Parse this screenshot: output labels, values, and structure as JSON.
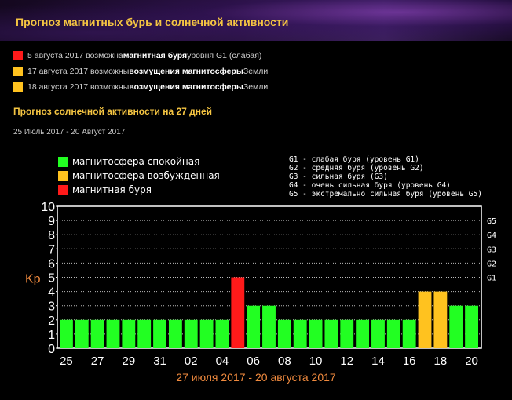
{
  "header": {
    "title": "Прогноз магнитных бурь и солнечной активности"
  },
  "alerts": [
    {
      "color": "#ff1a1a",
      "pre": "5 августа 2017 возможна ",
      "bold": "магнитная буря",
      "post": " уровня G1 (слабая)"
    },
    {
      "color": "#ffc21f",
      "pre": "17 августа 2017 возможны ",
      "bold": "возмущения магнитосферы",
      "post": " Земли"
    },
    {
      "color": "#ffc21f",
      "pre": "18 августа 2017 возможны ",
      "bold": "возмущения магнитосферы",
      "post": " Земли"
    }
  ],
  "forecast": {
    "title": "Прогноз солнечной активности на 27 дней",
    "date_range": "25 Июль 2017 - 20 Август 2017"
  },
  "legend": [
    {
      "label": "магнитосфера спокойная",
      "color": "#22ff22"
    },
    {
      "label": "магнитосфера возбужденная",
      "color": "#ffc21f"
    },
    {
      "label": "магнитная буря",
      "color": "#ff1a1a"
    }
  ],
  "storm_levels": [
    "G1 - слабая буря (уровень G1)",
    "G2 - средняя буря (уровень G2)",
    "G3 - сильная буря (G3)",
    "G4 - очень сильная буря (уровень G4)",
    "G5 - экстремально сильная буря (уровень G5)"
  ],
  "chart_data": {
    "type": "bar",
    "ylabel": "Kp",
    "ylim": [
      0,
      10
    ],
    "yticks": [
      "0",
      "1",
      "2",
      "3",
      "4",
      "5",
      "6",
      "7",
      "8",
      "9",
      "10"
    ],
    "right_ticks": [
      {
        "value": 5,
        "label": "G1"
      },
      {
        "value": 6,
        "label": "G2"
      },
      {
        "value": 7,
        "label": "G3"
      },
      {
        "value": 8,
        "label": "G4"
      },
      {
        "value": 9,
        "label": "G5"
      }
    ],
    "xticks": [
      "25",
      "27",
      "29",
      "31",
      "02",
      "04",
      "06",
      "08",
      "10",
      "12",
      "14",
      "16",
      "18",
      "20"
    ],
    "values": [
      2,
      2,
      2,
      2,
      2,
      2,
      2,
      2,
      2,
      2,
      2,
      5,
      3,
      3,
      2,
      2,
      2,
      2,
      2,
      2,
      2,
      2,
      2,
      4,
      4,
      3,
      3
    ],
    "colors": [
      "#22ff22",
      "#22ff22",
      "#22ff22",
      "#22ff22",
      "#22ff22",
      "#22ff22",
      "#22ff22",
      "#22ff22",
      "#22ff22",
      "#22ff22",
      "#22ff22",
      "#ff1a1a",
      "#22ff22",
      "#22ff22",
      "#22ff22",
      "#22ff22",
      "#22ff22",
      "#22ff22",
      "#22ff22",
      "#22ff22",
      "#22ff22",
      "#22ff22",
      "#22ff22",
      "#ffc21f",
      "#ffc21f",
      "#22ff22",
      "#22ff22"
    ],
    "grid": true,
    "caption": "27 июля 2017 - 20 августа 2017"
  }
}
